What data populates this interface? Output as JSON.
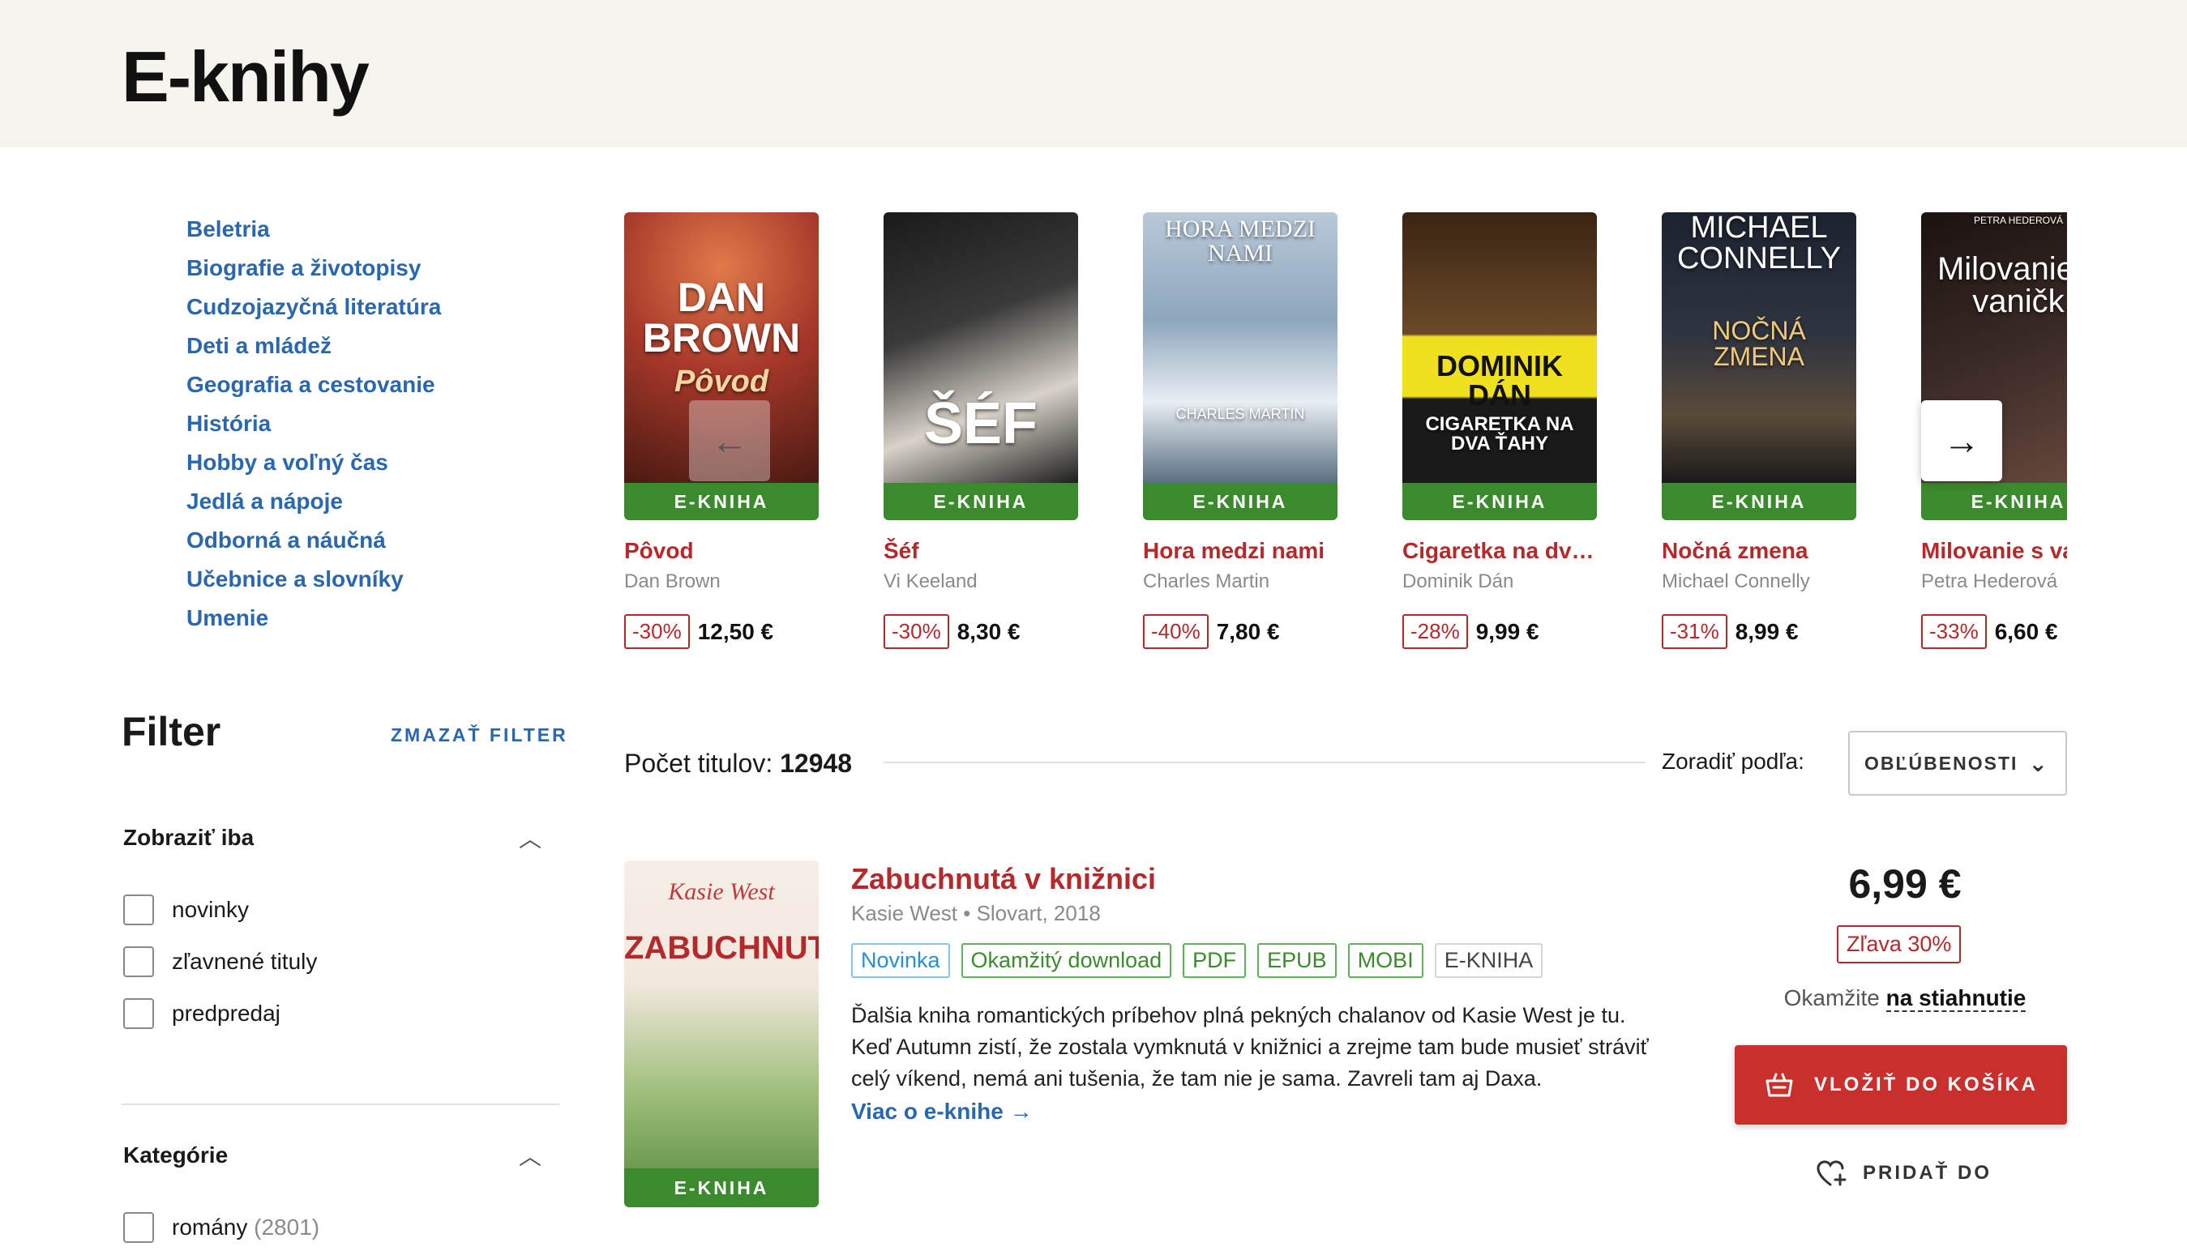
{
  "page": {
    "title": "E-knihy"
  },
  "categories": [
    "Beletria",
    "Biografie a životopisy",
    "Cudzojazyčná literatúra",
    "Deti a mládež",
    "Geografia a cestovanie",
    "História",
    "Hobby a voľný čas",
    "Jedlá a nápoje",
    "Odborná a náučná",
    "Učebnice a slovníky",
    "Umenie"
  ],
  "carousel": {
    "items": [
      {
        "title": "Pôvod",
        "author": "Dan Brown",
        "discount": "-30%",
        "price": "12,50 €",
        "badge": "E-KNIHA",
        "cover_text": "DAN BROWN",
        "cover_sub": "Pôvod",
        "color": "#a8382a"
      },
      {
        "title": "Šéf",
        "author": "Vi Keeland",
        "discount": "-30%",
        "price": "8,30 €",
        "badge": "E-KNIHA",
        "cover_text": "ŠÉF",
        "cover_sub": "",
        "color": "#2b2b2b"
      },
      {
        "title": "Hora medzi nami",
        "author": "Charles Martin",
        "discount": "-40%",
        "price": "7,80 €",
        "badge": "E-KNIHA",
        "cover_text": "HORA MEDZI NAMI",
        "cover_sub": "CHARLES MARTIN",
        "color": "#8ea6bd"
      },
      {
        "title": "Cigaretka na dva ťahy",
        "author": "Dominik Dán",
        "discount": "-28%",
        "price": "9,99 €",
        "badge": "E-KNIHA",
        "cover_text": "DOMINIK DÁN",
        "cover_sub": "CIGARETKA NA DVA ŤAHY",
        "color": "#6b4a2a"
      },
      {
        "title": "Nočná zmena",
        "author": "Michael Connelly",
        "discount": "-31%",
        "price": "8,99 €",
        "badge": "E-KNIHA",
        "cover_text": "MICHAEL CONNELLY",
        "cover_sub": "NOČNÁ ZMENA",
        "color": "#2e3440"
      },
      {
        "title": "Milovanie s vaničkou",
        "author": "Petra Hederová",
        "discount": "-33%",
        "price": "6,60 €",
        "badge": "E-KNIHA",
        "cover_text": "Milovanie s vaničk",
        "cover_sub": "PETRA HEDEROVÁ",
        "color": "#3a2a26"
      }
    ]
  },
  "filter": {
    "title": "Filter",
    "clear": "ZMAZAŤ FILTER",
    "show_only": {
      "heading": "Zobraziť iba",
      "options": [
        "novinky",
        "zľavnené tituly",
        "predpredaj"
      ]
    },
    "category": {
      "heading": "Kategórie",
      "options": [
        {
          "label": "romány",
          "count": "(2801)"
        }
      ]
    }
  },
  "results": {
    "count_label": "Počet titulov:",
    "count": "12948",
    "sort_label": "Zoradiť podľa:",
    "sort_value": "OBĽÚBENOSTI"
  },
  "item": {
    "title": "Zabuchnutá v knižnici",
    "meta": "Kasie West • Slovart, 2018",
    "tags": [
      "Novinka",
      "Okamžitý download",
      "PDF",
      "EPUB",
      "MOBI",
      "E-KNIHA"
    ],
    "description": "Ďalšia kniha romantických príbehov plná pekných chalanov od Kasie West je tu. Keď Autumn zistí, že zostala vymknutá v knižnici a zrejme tam bude musieť stráviť celý víkend, nemá ani tušenia, že tam nie je sama. Zavreli tam aj Daxa.",
    "more": "Viac o e-knihe →",
    "price": "6,99 €",
    "discount": "Zľava 30%",
    "avail_prefix": "Okamžite",
    "avail_link": "na stiahnutie",
    "cart": "VLOŽIŤ DO KOŠÍKA",
    "wish": "PRIDAŤ DO",
    "badge": "E-KNIHA",
    "cover_text": "ZABUCHNUTÁ",
    "cover_sub": "Kasie West"
  },
  "icons": {
    "prev": "arrow-left-icon",
    "next": "arrow-right-icon",
    "cart": "basket-icon",
    "wish": "heart-plus-icon",
    "chevron": "chevron-up-icon",
    "dropdown": "chevron-down-icon"
  },
  "colors": {
    "accent_red": "#b6292b",
    "link_blue": "#2a67b1",
    "badge_green": "#3b8b2e",
    "hero_bg": "#f7f3ef"
  }
}
